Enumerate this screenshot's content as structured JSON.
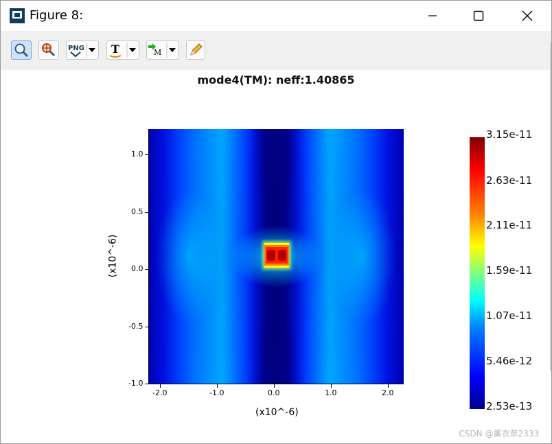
{
  "window": {
    "title": "Figure 8:"
  },
  "toolbar": {
    "buttons": [
      {
        "name": "zoom",
        "icon": "magnifier-icon"
      },
      {
        "name": "pan-zoom",
        "icon": "magnifier-cross-icon"
      },
      {
        "name": "png",
        "label": "PNG",
        "icon": "png-export-icon"
      },
      {
        "name": "text",
        "label": "T",
        "icon": "text-icon"
      },
      {
        "name": "marker",
        "label": "M",
        "icon": "marker-icon"
      },
      {
        "name": "pencil",
        "icon": "pencil-icon"
      }
    ]
  },
  "plot": {
    "title": "mode4(TM): neff:1.40865",
    "xlabel": "(x10^-6)",
    "ylabel": "(x10^-6)",
    "x_ticks": [
      "-2.0",
      "-1.0",
      "0.0",
      "1.0",
      "2.0"
    ],
    "y_ticks": [
      "1.0",
      "0.5",
      "0.0",
      "-0.5",
      "-1.0"
    ]
  },
  "colorbar": {
    "labels": [
      "3.15e-11",
      "2.63e-11",
      "2.11e-11",
      "1.59e-11",
      "1.07e-11",
      "5.46e-12",
      "2.53e-13"
    ]
  },
  "chart_data": {
    "type": "heatmap",
    "title": "mode4(TM): neff:1.40865",
    "xlabel": "(x10^-6)",
    "ylabel": "(x10^-6)",
    "xlim": [
      -2.25,
      2.25
    ],
    "ylim": [
      -1.0,
      1.2
    ],
    "x_ticks": [
      -2.0,
      -1.0,
      0.0,
      1.0,
      2.0
    ],
    "y_ticks": [
      -1.0,
      -0.5,
      0.0,
      0.5,
      1.0
    ],
    "colormap": "jet",
    "value_range": [
      2.53e-13,
      3.15e-11
    ],
    "colorbar_ticks": [
      2.53e-13,
      5.46e-12,
      1.07e-11,
      1.59e-11,
      2.11e-11,
      2.63e-11,
      3.15e-11
    ],
    "hotspot": {
      "x": 0.0,
      "y": 0.12,
      "peak": 3.15e-11
    }
  },
  "watermark": "CSDN @薰衣草2333"
}
